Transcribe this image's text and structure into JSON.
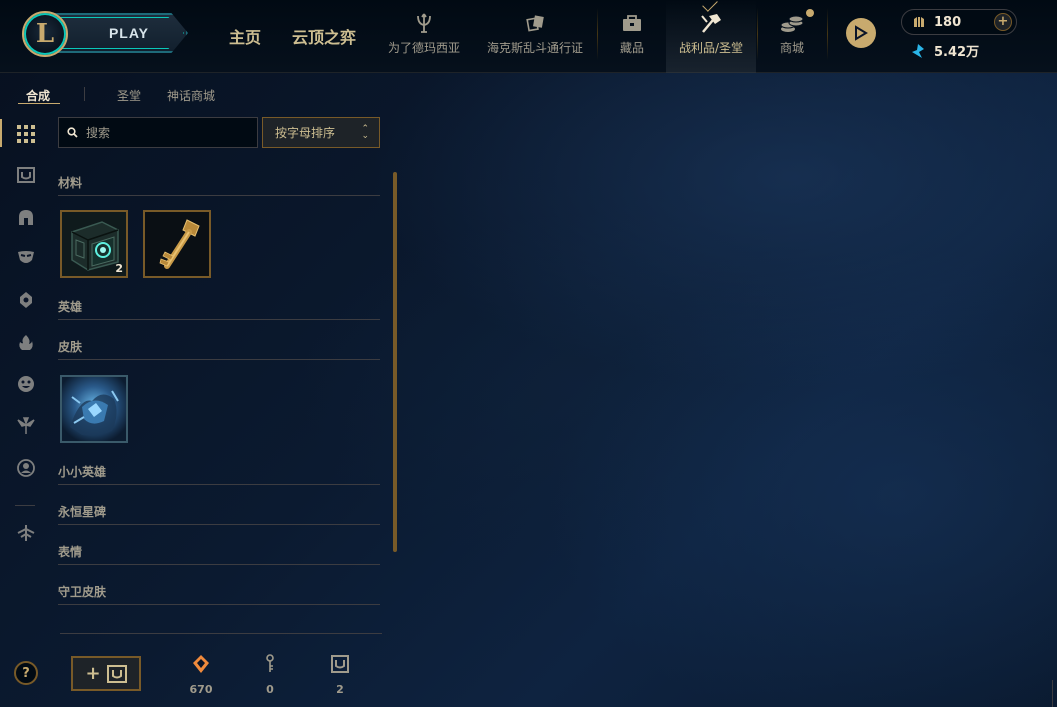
{
  "header": {
    "logo_letter": "L",
    "play_label": "PLAY",
    "nav_main": [
      {
        "id": "home",
        "label": "主页"
      },
      {
        "id": "tft",
        "label": "云顶之弈"
      }
    ],
    "nav_items": [
      {
        "id": "demacia",
        "label": "为了德玛西亚",
        "icon": "trident-icon"
      },
      {
        "id": "pass",
        "label": "海克斯乱斗通行证",
        "icon": "cards-icon"
      },
      {
        "id": "collection",
        "label": "藏品",
        "icon": "bag-icon"
      },
      {
        "id": "loot",
        "label": "战利品/圣堂",
        "icon": "hammer-icon",
        "active": true
      },
      {
        "id": "store",
        "label": "商城",
        "icon": "coins-icon"
      }
    ],
    "wallet": {
      "rp": "180",
      "be": "5.42万"
    }
  },
  "subnav": {
    "tabs": [
      {
        "label": "合成",
        "active": true
      },
      {
        "label": "圣堂"
      },
      {
        "label": "神话商城"
      }
    ]
  },
  "rail": [
    "grid-icon",
    "chest-icon",
    "helmet-icon",
    "mask-icon",
    "ward-icon",
    "flame-icon",
    "emote-icon",
    "tree-icon",
    "profile-icon",
    "arrow-icon"
  ],
  "toolbar": {
    "search_placeholder": "搜索",
    "sort_label": "按字母排序"
  },
  "categories": [
    {
      "label": "材料",
      "items": [
        {
          "name": "hextech-chest",
          "count": "2"
        },
        {
          "name": "hextech-key",
          "count": ""
        }
      ]
    },
    {
      "label": "英雄",
      "items": []
    },
    {
      "label": "皮肤",
      "items": [
        {
          "name": "skin-shard",
          "count": ""
        }
      ]
    },
    {
      "label": "小小英雄",
      "items": []
    },
    {
      "label": "永恒星碑",
      "items": []
    },
    {
      "label": "表情",
      "items": []
    },
    {
      "label": "守卫皮肤",
      "items": []
    }
  ],
  "footer": {
    "craft_label": "+",
    "resources": [
      {
        "name": "orange-essence",
        "value": "670"
      },
      {
        "name": "key-fragment",
        "value": "0"
      },
      {
        "name": "chest",
        "value": "2"
      }
    ]
  },
  "colors": {
    "gold": "#c8aa6e",
    "gold_dark": "#785a28",
    "teal": "#0ac8b9",
    "bg": "#0a1428",
    "orange": "#f08a3c",
    "blue_gem": "#2ab5e8"
  }
}
